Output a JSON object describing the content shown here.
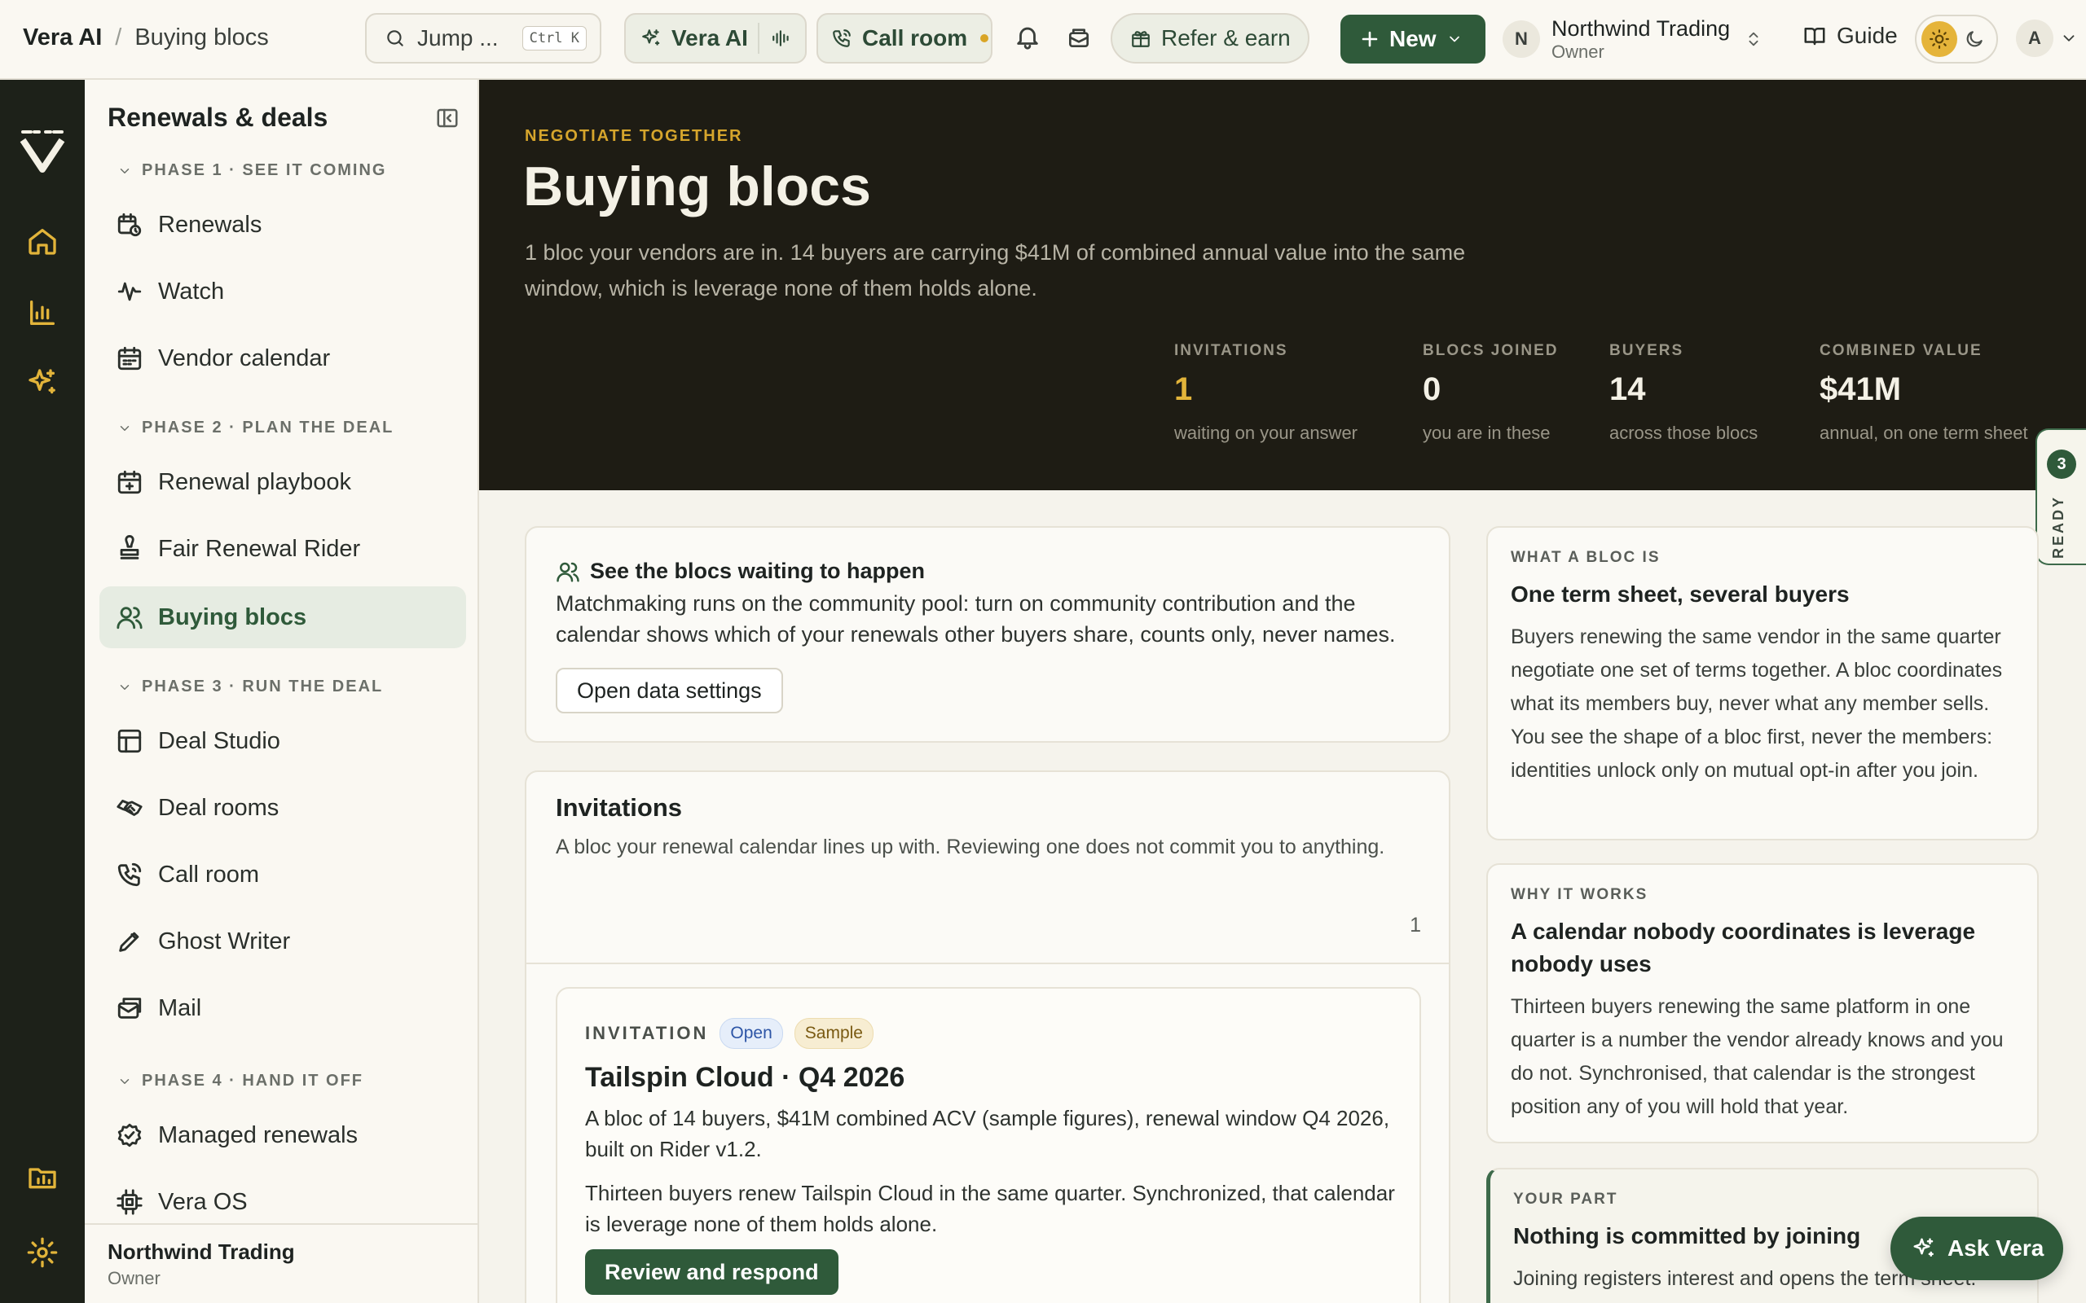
{
  "topbar": {
    "app_name": "Vera AI",
    "breadcrumb_sep": "/",
    "page_name": "Buying blocs",
    "search_placeholder": "Jump ...",
    "search_shortcut": "Ctrl K",
    "vera_label": "Vera AI",
    "call_room_label": "Call room",
    "refer_label": "Refer & earn",
    "new_label": "New",
    "org_initial": "N",
    "org_name": "Northwind Trading",
    "org_role": "Owner",
    "guide_label": "Guide",
    "user_initial": "A"
  },
  "sidebar": {
    "title": "Renewals & deals",
    "phases": [
      {
        "label": "PHASE 1 · SEE IT COMING",
        "items": [
          {
            "label": "Renewals",
            "icon": "clock-calendar-icon"
          },
          {
            "label": "Watch",
            "icon": "pulse-icon"
          },
          {
            "label": "Vendor calendar",
            "icon": "calendar-icon"
          }
        ]
      },
      {
        "label": "PHASE 2 · PLAN THE DEAL",
        "items": [
          {
            "label": "Renewal playbook",
            "icon": "calendar-plus-icon"
          },
          {
            "label": "Fair Renewal Rider",
            "icon": "stamp-icon"
          },
          {
            "label": "Buying blocs",
            "icon": "users-icon",
            "active": true
          }
        ]
      },
      {
        "label": "PHASE 3 · RUN THE DEAL",
        "items": [
          {
            "label": "Deal Studio",
            "icon": "layout-icon"
          },
          {
            "label": "Deal rooms",
            "icon": "handshake-icon"
          },
          {
            "label": "Call room",
            "icon": "phone-icon"
          },
          {
            "label": "Ghost Writer",
            "icon": "pen-icon"
          },
          {
            "label": "Mail",
            "icon": "mail-icon"
          }
        ]
      },
      {
        "label": "PHASE 4 · HAND IT OFF",
        "items": [
          {
            "label": "Managed renewals",
            "icon": "check-badge-icon"
          },
          {
            "label": "Vera OS",
            "icon": "chip-icon"
          }
        ]
      }
    ],
    "footer_name": "Northwind Trading",
    "footer_role": "Owner"
  },
  "hero": {
    "eyebrow": "NEGOTIATE TOGETHER",
    "title": "Buying blocs",
    "subtitle": "1 bloc your vendors are in. 14 buyers are carrying $41M of combined annual value into the same window, which is leverage none of them holds alone.",
    "stats": [
      {
        "label": "INVITATIONS",
        "value": "1",
        "sub": "waiting on your answer"
      },
      {
        "label": "BLOCS JOINED",
        "value": "0",
        "sub": "you are in these"
      },
      {
        "label": "BUYERS",
        "value": "14",
        "sub": "across those blocs"
      },
      {
        "label": "COMBINED VALUE",
        "value": "$41M",
        "sub": "annual, on one term sheet"
      }
    ]
  },
  "ready_tab": {
    "count": "3",
    "label": "READY"
  },
  "matchmaking": {
    "title": "See the blocs waiting to happen",
    "body": "Matchmaking runs on the community pool: turn on community contribution and the calendar shows which of your renewals other buyers share, counts only, never names.",
    "button": "Open data settings"
  },
  "invitations": {
    "title": "Invitations",
    "description": "A bloc your renewal calendar lines up with. Reviewing one does not commit you to anything.",
    "count": "1",
    "items": [
      {
        "kind": "INVITATION",
        "status": "Open",
        "tag": "Sample",
        "name": "Tailspin Cloud · Q4 2026",
        "summary": "A bloc of 14 buyers, $41M combined ACV (sample figures), renewal window Q4 2026, built on Rider v1.2.",
        "detail": "Thirteen buyers renew Tailspin Cloud in the same quarter. Synchronized, that calendar is leverage none of them holds alone.",
        "action": "Review and respond"
      }
    ]
  },
  "info_cards": [
    {
      "eyebrow": "WHAT A BLOC IS",
      "title": "One term sheet, several buyers",
      "body": "Buyers renewing the same vendor in the same quarter negotiate one set of terms together. A bloc coordinates what its members buy, never what any member sells. You see the shape of a bloc first, never the members: identities unlock only on mutual opt-in after you join."
    },
    {
      "eyebrow": "WHY IT WORKS",
      "title": "A calendar nobody coordinates is leverage nobody uses",
      "body": "Thirteen buyers renewing the same platform in one quarter is a number the vendor already knows and you do not. Synchronised, that calendar is the strongest position any of you will hold that year."
    },
    {
      "eyebrow": "YOUR PART",
      "title": "Nothing is committed by joining",
      "body": "Joining registers interest and opens the term sheet."
    }
  ],
  "ask_vera": {
    "label": "Ask Vera"
  },
  "colors": {
    "accent": "#2f5a3a",
    "gold": "#e2b43a",
    "hero_bg": "#1e1c14",
    "rail_bg": "#1d2119"
  }
}
